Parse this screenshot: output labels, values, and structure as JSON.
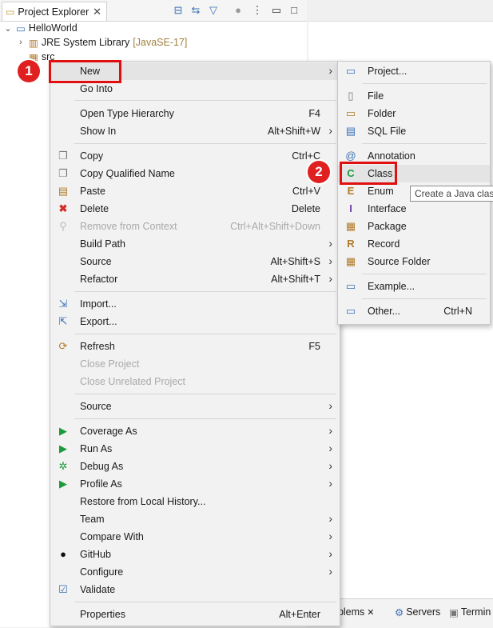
{
  "explorer": {
    "tab_title": "Project Explorer",
    "tree": [
      {
        "label": "HelloWorld",
        "suffix": ""
      },
      {
        "label": "JRE System Library",
        "suffix": "[JavaSE-17]"
      },
      {
        "label": "src",
        "suffix": ""
      }
    ]
  },
  "context_menu": {
    "items": [
      {
        "label": "New",
        "accel": "",
        "submenu": true
      },
      {
        "label": "Go Into",
        "accel": ""
      },
      {
        "label": "Open Type Hierarchy",
        "accel": "F4"
      },
      {
        "label": "Show In",
        "accel": "Alt+Shift+W",
        "submenu": true
      },
      {
        "label": "Copy",
        "accel": "Ctrl+C"
      },
      {
        "label": "Copy Qualified Name",
        "accel": ""
      },
      {
        "label": "Paste",
        "accel": "Ctrl+V"
      },
      {
        "label": "Delete",
        "accel": "Delete"
      },
      {
        "label": "Remove from Context",
        "accel": "Ctrl+Alt+Shift+Down",
        "disabled": true
      },
      {
        "label": "Build Path",
        "accel": "",
        "submenu": true
      },
      {
        "label": "Source",
        "accel": "Alt+Shift+S",
        "submenu": true
      },
      {
        "label": "Refactor",
        "accel": "Alt+Shift+T",
        "submenu": true
      },
      {
        "label": "Import...",
        "accel": ""
      },
      {
        "label": "Export...",
        "accel": ""
      },
      {
        "label": "Refresh",
        "accel": "F5"
      },
      {
        "label": "Close Project",
        "accel": "",
        "disabled": true
      },
      {
        "label": "Close Unrelated Project",
        "accel": "",
        "disabled": true
      },
      {
        "label": "Source",
        "accel": "",
        "submenu": true
      },
      {
        "label": "Coverage As",
        "accel": "",
        "submenu": true
      },
      {
        "label": "Run As",
        "accel": "",
        "submenu": true
      },
      {
        "label": "Debug As",
        "accel": "",
        "submenu": true
      },
      {
        "label": "Profile As",
        "accel": "",
        "submenu": true
      },
      {
        "label": "Restore from Local History...",
        "accel": ""
      },
      {
        "label": "Team",
        "accel": "",
        "submenu": true
      },
      {
        "label": "Compare With",
        "accel": "",
        "submenu": true
      },
      {
        "label": "GitHub",
        "accel": "",
        "submenu": true
      },
      {
        "label": "Configure",
        "accel": "",
        "submenu": true
      },
      {
        "label": "Validate",
        "accel": ""
      },
      {
        "label": "Properties",
        "accel": "Alt+Enter"
      }
    ]
  },
  "new_submenu": {
    "items": [
      {
        "label": "Project...",
        "accel": ""
      },
      {
        "label": "File",
        "accel": ""
      },
      {
        "label": "Folder",
        "accel": ""
      },
      {
        "label": "SQL File",
        "accel": ""
      },
      {
        "label": "Annotation",
        "accel": ""
      },
      {
        "label": "Class",
        "accel": ""
      },
      {
        "label": "Enum",
        "accel": ""
      },
      {
        "label": "Interface",
        "accel": ""
      },
      {
        "label": "Package",
        "accel": ""
      },
      {
        "label": "Record",
        "accel": ""
      },
      {
        "label": "Source Folder",
        "accel": ""
      },
      {
        "label": "Example...",
        "accel": ""
      },
      {
        "label": "Other...",
        "accel": "Ctrl+N"
      }
    ]
  },
  "tooltip": "Create a Java class",
  "annotations": {
    "step1": "1",
    "step2": "2"
  },
  "bottom_tabs": {
    "problems": "oblems",
    "servers": "Servers",
    "terminal": "Termin"
  },
  "colors": {
    "annotation_red": "#e01010",
    "menu_bg": "#f2f2f2",
    "highlight": "#e4e4e4"
  }
}
